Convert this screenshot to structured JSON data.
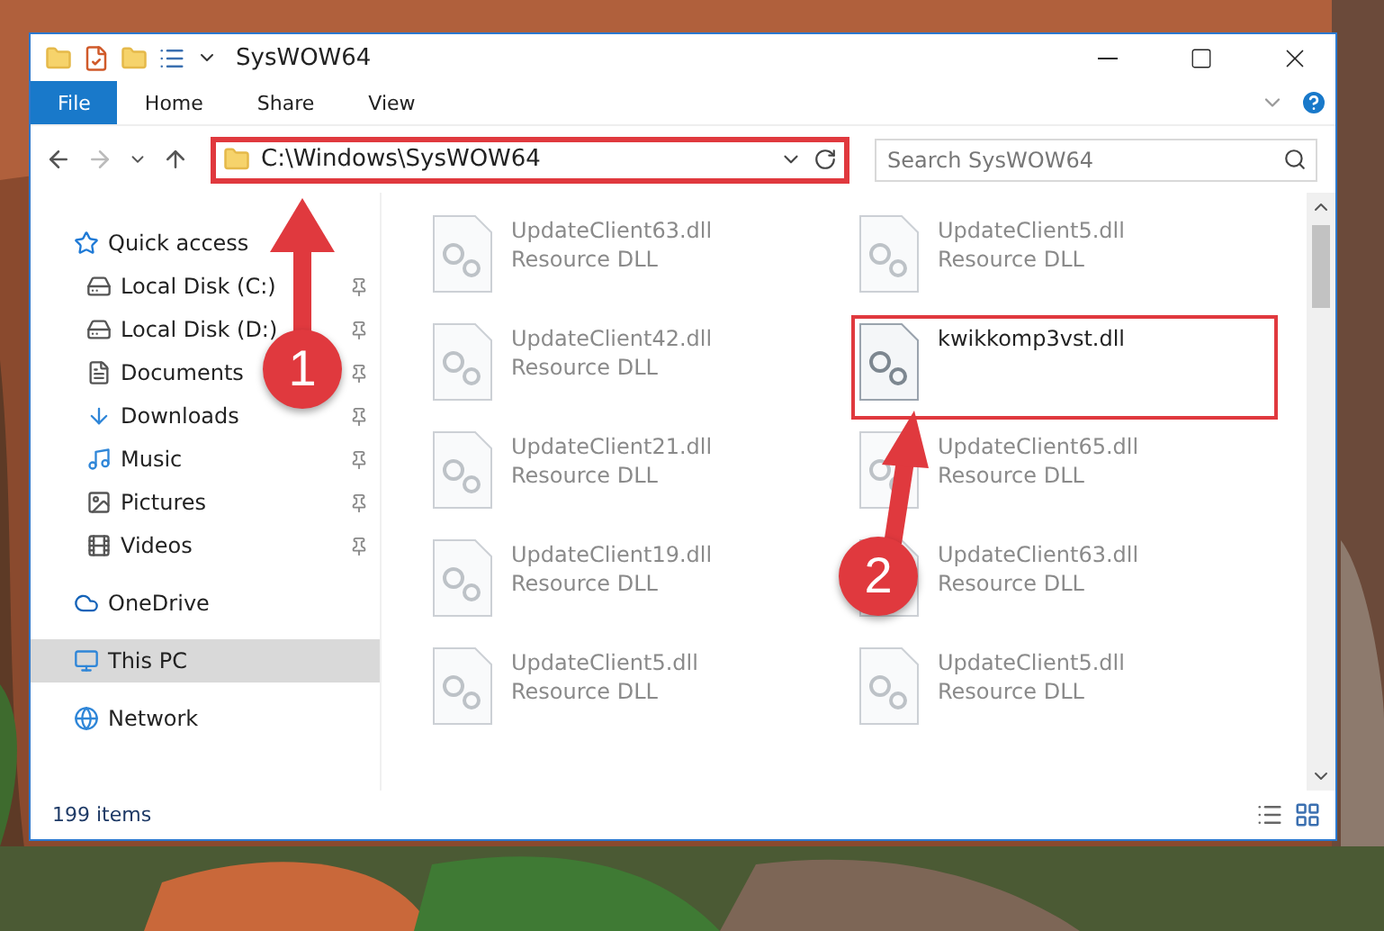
{
  "window": {
    "title": "SysWOW64"
  },
  "ribbon": {
    "tabs": [
      {
        "label": "File",
        "selected": true
      },
      {
        "label": "Home",
        "selected": false
      },
      {
        "label": "Share",
        "selected": false
      },
      {
        "label": "View",
        "selected": false
      }
    ]
  },
  "address": {
    "path": "C:\\Windows\\SysWOW64",
    "highlighted": true
  },
  "search": {
    "placeholder": "Search SysWOW64"
  },
  "sidebar": {
    "items": [
      {
        "label": "Quick access",
        "kind": "star",
        "selected": false,
        "children": [
          {
            "label": "Local Disk (C:)",
            "kind": "system-drive",
            "pinned": true,
            "selected": false
          },
          {
            "label": "Local Disk (D:)",
            "kind": "drive",
            "pinned": true,
            "selected": false
          },
          {
            "label": "Documents",
            "kind": "documents",
            "pinned": true,
            "selected": false
          },
          {
            "label": "Downloads",
            "kind": "downloads",
            "pinned": true,
            "selected": false
          },
          {
            "label": "Music",
            "kind": "music",
            "pinned": true,
            "selected": false
          },
          {
            "label": "Pictures",
            "kind": "pictures",
            "pinned": true,
            "selected": false
          },
          {
            "label": "Videos",
            "kind": "videos",
            "pinned": true,
            "selected": false
          }
        ]
      },
      {
        "label": "OneDrive",
        "kind": "cloud",
        "selected": false
      },
      {
        "label": "This PC",
        "kind": "pc",
        "selected": true
      },
      {
        "label": "Network",
        "kind": "network",
        "selected": false
      }
    ]
  },
  "files": [
    {
      "name": "UpdateClient63.dll",
      "type": "Resource DLL",
      "highlighted": false
    },
    {
      "name": "UpdateClient5.dll",
      "type": "Resource DLL",
      "highlighted": false
    },
    {
      "name": "UpdateClient42.dll",
      "type": "Resource DLL",
      "highlighted": false
    },
    {
      "name": "kwikkomp3vst.dll",
      "highlighted": true
    },
    {
      "name": "UpdateClient21.dll",
      "type": "Resource DLL",
      "highlighted": false
    },
    {
      "name": "UpdateClient65.dll",
      "type": "Resource DLL",
      "highlighted": false
    },
    {
      "name": "UpdateClient19.dll",
      "type": "Resource DLL",
      "highlighted": false
    },
    {
      "name": "UpdateClient63.dll",
      "type": "Resource DLL",
      "highlighted": false
    },
    {
      "name": "UpdateClient5.dll",
      "type": "Resource DLL",
      "highlighted": false
    },
    {
      "name": "UpdateClient5.dll",
      "type": "Resource DLL",
      "highlighted": false
    }
  ],
  "status_bar": {
    "count": "199 items"
  },
  "callouts": [
    {
      "number": "1"
    },
    {
      "number": "2"
    }
  ]
}
